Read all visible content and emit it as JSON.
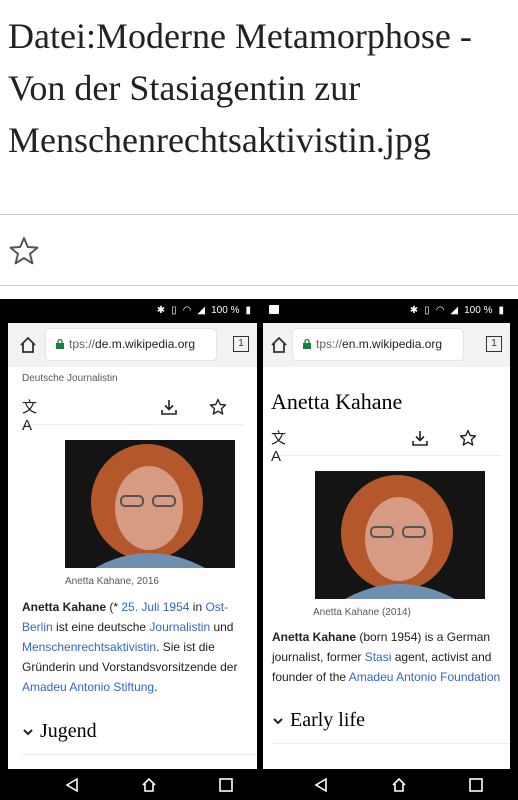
{
  "page": {
    "title": "Datei:Moderne Metamorphose - Von der Stasiagentin zur Menschenrechtsaktivistin.jpg"
  },
  "left_phone": {
    "battery": "100 %",
    "tab_count": "1",
    "url_prefix": "tps://",
    "url_domain": "de.m.wikipedia.org",
    "description": "Deutsche Journalistin",
    "caption": "Anetta Kahane, 2016",
    "lead": {
      "name": "Anetta Kahane",
      "t1": " (* ",
      "link_date": "25. Juli 1954",
      "t2": " in ",
      "link_place": "Ost-Berlin",
      "t3": " ist eine deutsche ",
      "link_journalist": "Journalistin",
      "t4": " und ",
      "link_activist": "Menschenrechtsaktivistin",
      "t5": ". Sie ist die Gründerin und Vorstandsvorsitzende der ",
      "link_foundation": "Amadeu Antonio Stiftung",
      "t6": "."
    },
    "section": "Jugend"
  },
  "right_phone": {
    "battery": "100 %",
    "tab_count": "1",
    "url_prefix": "tps://",
    "url_domain": "en.m.wikipedia.org",
    "article_title": "Anetta Kahane",
    "caption": "Anetta Kahane (2014)",
    "lead": {
      "name": "Anetta Kahane",
      "t1": " (born 1954) is a German journalist, former ",
      "link_stasi": "Stasi",
      "t2": " agent, activist and founder of the ",
      "link_foundation": "Amadeu Antonio Foundation"
    },
    "section": "Early life"
  },
  "colors": {
    "link": "#3366cc",
    "lock": "#188038",
    "divider": "#c8ccd1"
  }
}
